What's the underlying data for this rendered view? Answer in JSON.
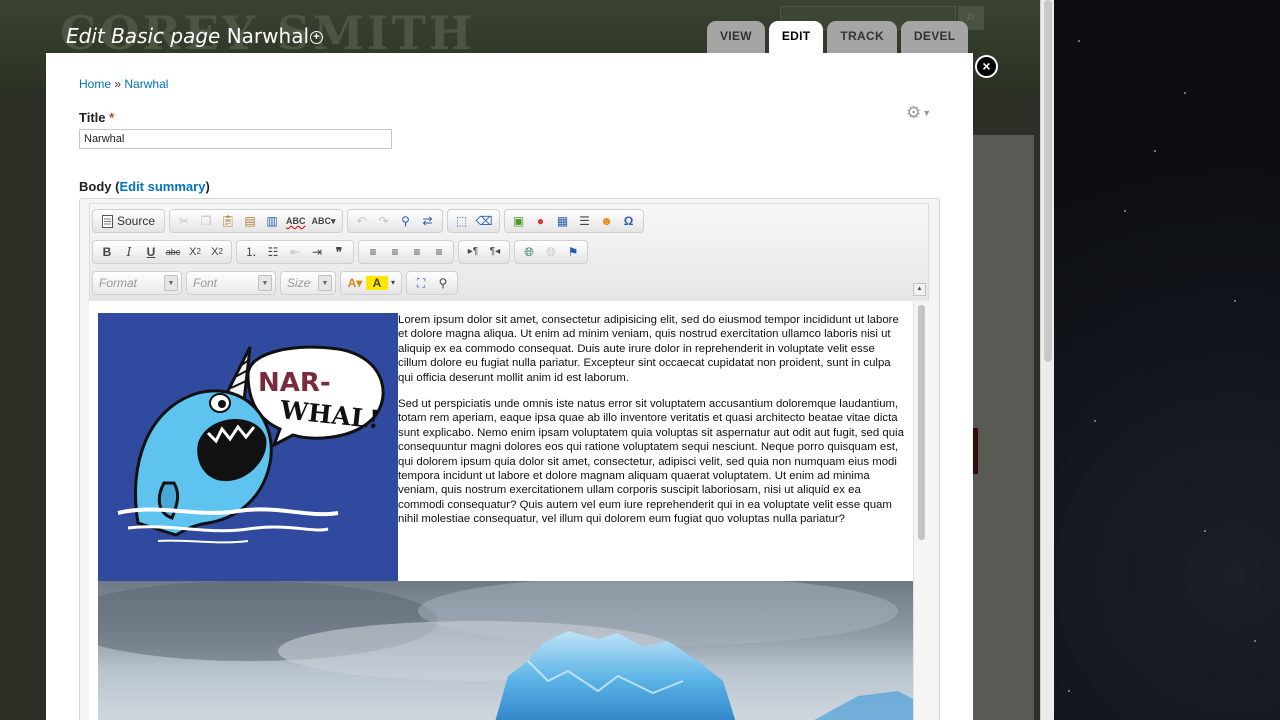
{
  "background": {
    "site_name": "COREY SMITH"
  },
  "overlay": {
    "title_prefix": "Edit Basic page",
    "title_node": "Narwhal",
    "tabs": [
      {
        "label": "VIEW",
        "active": false
      },
      {
        "label": "EDIT",
        "active": true
      },
      {
        "label": "TRACK",
        "active": false
      },
      {
        "label": "DEVEL",
        "active": false
      }
    ],
    "close_glyph": "×"
  },
  "breadcrumb": {
    "home": "Home",
    "separator": "»",
    "current": "Narwhal"
  },
  "form": {
    "title_label": "Title",
    "required_mark": "*",
    "title_value": "Narwhal",
    "body_label": "Body",
    "edit_summary_label": "Edit summary"
  },
  "toolbar": {
    "source_label": "Source",
    "format_placeholder": "Format",
    "font_placeholder": "Font",
    "size_placeholder": "Size"
  },
  "content": {
    "narwhal_bubble_line1": "NAR-",
    "narwhal_bubble_line2": "WHAL!",
    "paragraph1": "Lorem ipsum dolor sit amet, consectetur adipisicing elit, sed do eiusmod tempor incididunt ut labore et dolore magna aliqua. Ut enim ad minim veniam, quis nostrud exercitation ullamco laboris nisi ut aliquip ex ea commodo consequat. Duis aute irure dolor in reprehenderit in voluptate velit esse cillum dolore eu fugiat nulla pariatur. Excepteur sint occaecat cupidatat non proident, sunt in culpa qui officia deserunt mollit anim id est laborum.",
    "paragraph2": "Sed ut perspiciatis unde omnis iste natus error sit voluptatem accusantium doloremque laudantium, totam rem aperiam, eaque ipsa quae ab illo inventore veritatis et quasi architecto beatae vitae dicta sunt explicabo. Nemo enim ipsam voluptatem quia voluptas sit aspernatur aut odit aut fugit, sed quia consequuntur magni dolores eos qui ratione voluptatem sequi nesciunt. Neque porro quisquam est, qui dolorem ipsum quia dolor sit amet, consectetur, adipisci velit, sed quia non numquam eius modi tempora incidunt ut labore et dolore magnam aliquam quaerat voluptatem. Ut enim ad minima veniam, quis nostrum exercitationem ullam corporis suscipit laboriosam, nisi ut aliquid ex ea commodi consequatur? Quis autem vel eum iure reprehenderit qui in ea voluptate velit esse quam nihil molestiae consequatur, vel illum qui dolorem eum fugiat quo voluptas nulla pariatur?"
  }
}
